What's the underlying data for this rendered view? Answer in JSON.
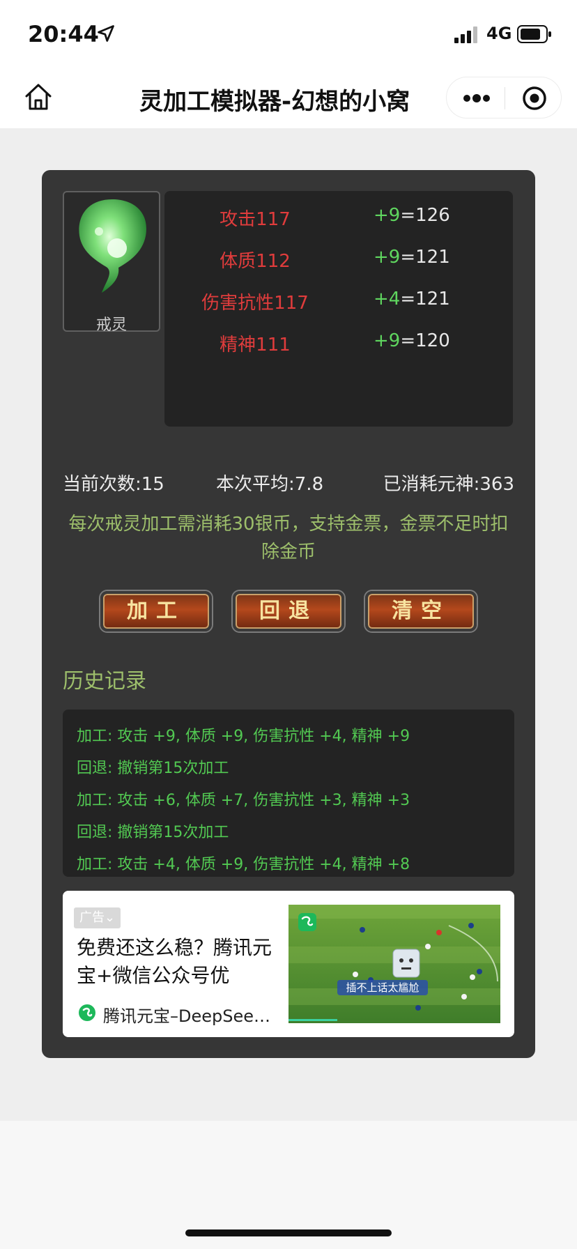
{
  "status_bar": {
    "time": "20:44",
    "network": "4G"
  },
  "nav": {
    "title": "灵加工模拟器-幻想的小窝"
  },
  "item": {
    "name": "戒灵"
  },
  "stats": [
    {
      "name": "攻击117",
      "plus": "+9",
      "result": "=126"
    },
    {
      "name": "体质112",
      "plus": "+9",
      "result": "=121"
    },
    {
      "name": "伤害抗性117",
      "plus": "+4",
      "result": "=121"
    },
    {
      "name": "精神111",
      "plus": "+9",
      "result": "=120"
    }
  ],
  "counters": {
    "current": "当前次数:15",
    "average": "本次平均:7.8",
    "consumed": "已消耗元神:363"
  },
  "notice": "每次戒灵加工需消耗30银币，支持金票，金票不足时扣除金币",
  "buttons": {
    "process": "加工",
    "undo": "回退",
    "clear": "清空"
  },
  "history": {
    "title": "历史记录",
    "lines": [
      "加工: 攻击 +9, 体质 +9, 伤害抗性 +4, 精神 +9",
      "回退: 撤销第15次加工",
      "加工: 攻击 +6, 体质 +7, 伤害抗性 +3, 精神 +3",
      "回退: 撤销第15次加工",
      "加工: 攻击 +4, 体质 +9, 伤害抗性 +4, 精神 +8"
    ]
  },
  "ad": {
    "tag": "广告⌄",
    "title": "免费还这么稳？腾讯元宝+微信公众号优",
    "brand": "腾讯元宝–DeepSeek…",
    "image_caption": "插不上话太尴尬"
  }
}
